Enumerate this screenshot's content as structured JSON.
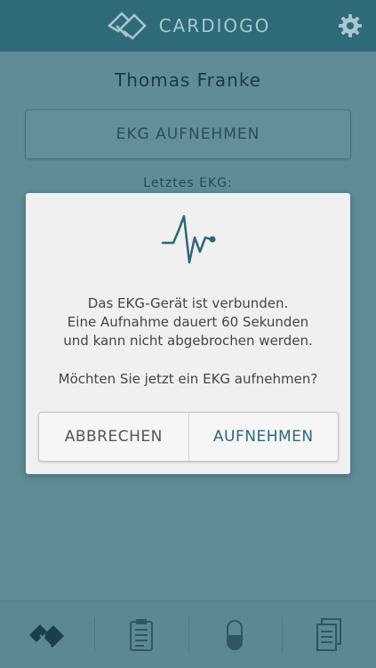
{
  "header": {
    "app_name": "CARDIOGO",
    "logo_icon": "cardiogo-logo-icon",
    "settings_icon": "gear-icon"
  },
  "main": {
    "patient_name": "Thomas Franke",
    "record_button_label": "EKG AUFNEHMEN",
    "last_ekg_label": "Letztes EKG:"
  },
  "dialog": {
    "icon": "ekg-pulse-icon",
    "message_lines": [
      "Das EKG-Gerät ist verbunden.",
      "Eine Aufnahme dauert 60 Sekunden",
      "und kann nicht abgebrochen werden."
    ],
    "question": "Möchten Sie jetzt ein EKG aufnehmen?",
    "cancel_label": "ABBRECHEN",
    "confirm_label": "AUFNEHMEN"
  },
  "tabbar": {
    "tabs": [
      {
        "icon": "cardiogo-logo-icon"
      },
      {
        "icon": "clipboard-icon"
      },
      {
        "icon": "pill-icon"
      },
      {
        "icon": "documents-icon"
      }
    ]
  },
  "colors": {
    "header_bg": "#2f6a79",
    "screen_bg": "#5f8c96",
    "accent": "#2b6779",
    "dialog_bg": "#f0f0f0"
  }
}
